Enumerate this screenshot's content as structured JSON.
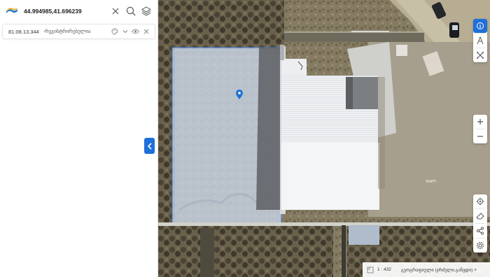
{
  "search": {
    "value": "44.994985,41.696239",
    "clear_icon": "close-icon",
    "search_icon": "search-icon",
    "layers_icon": "layers-icon"
  },
  "parcel": {
    "code": "81.08.13.344",
    "status": "-რეგისტრირებულია"
  },
  "map": {
    "building_label": "ЖАРП"
  },
  "bottom_bar": {
    "scale": "1 : 432",
    "layer": "გეოგრაფიული (ჯრძელი.განედი)",
    "chevron": "˅"
  },
  "colors": {
    "accent": "#1f6fd8",
    "parcel_fill": "#c9d7ea",
    "parcel_stroke": "#3a78d4"
  }
}
